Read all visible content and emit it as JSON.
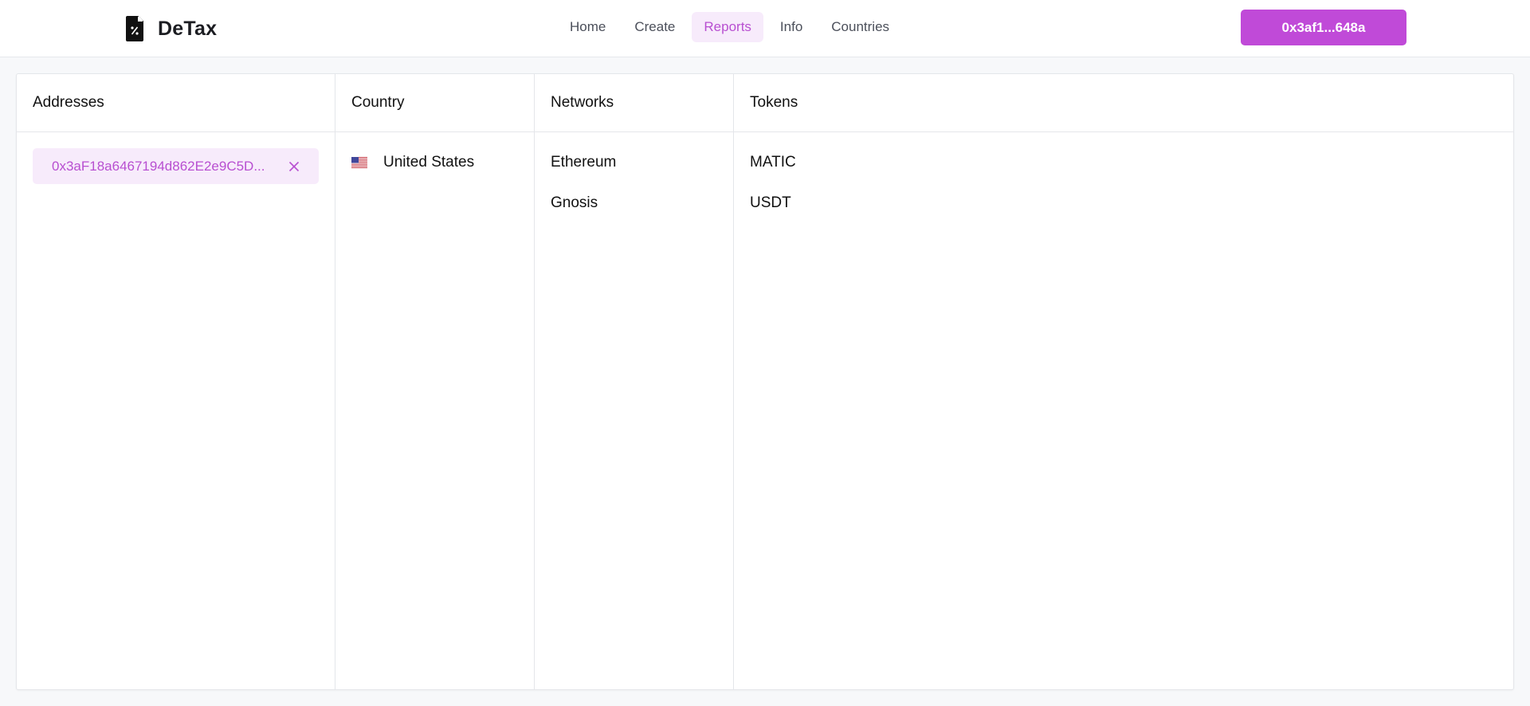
{
  "header": {
    "brand_name": "DeTax",
    "logo_icon": "file-percent-icon",
    "nav": [
      {
        "label": "Home",
        "active": false
      },
      {
        "label": "Create",
        "active": false
      },
      {
        "label": "Reports",
        "active": true
      },
      {
        "label": "Info",
        "active": false
      },
      {
        "label": "Countries",
        "active": false
      }
    ],
    "wallet_label": "0x3af1...648a"
  },
  "colors": {
    "accent": "#c04ad8",
    "accent_text": "#b84fd1",
    "accent_bg": "#f7ebfb"
  },
  "columns": {
    "addresses": {
      "header": "Addresses",
      "items": [
        {
          "address": "0x3aF18a6467194d862E2e9C5D...",
          "remove_icon": "close-icon"
        }
      ]
    },
    "country": {
      "header": "Country",
      "items": [
        {
          "name": "United States",
          "flag_icon": "us-flag-icon"
        }
      ]
    },
    "networks": {
      "header": "Networks",
      "items": [
        "Ethereum",
        "Gnosis"
      ]
    },
    "tokens": {
      "header": "Tokens",
      "items": [
        "MATIC",
        "USDT"
      ]
    }
  }
}
